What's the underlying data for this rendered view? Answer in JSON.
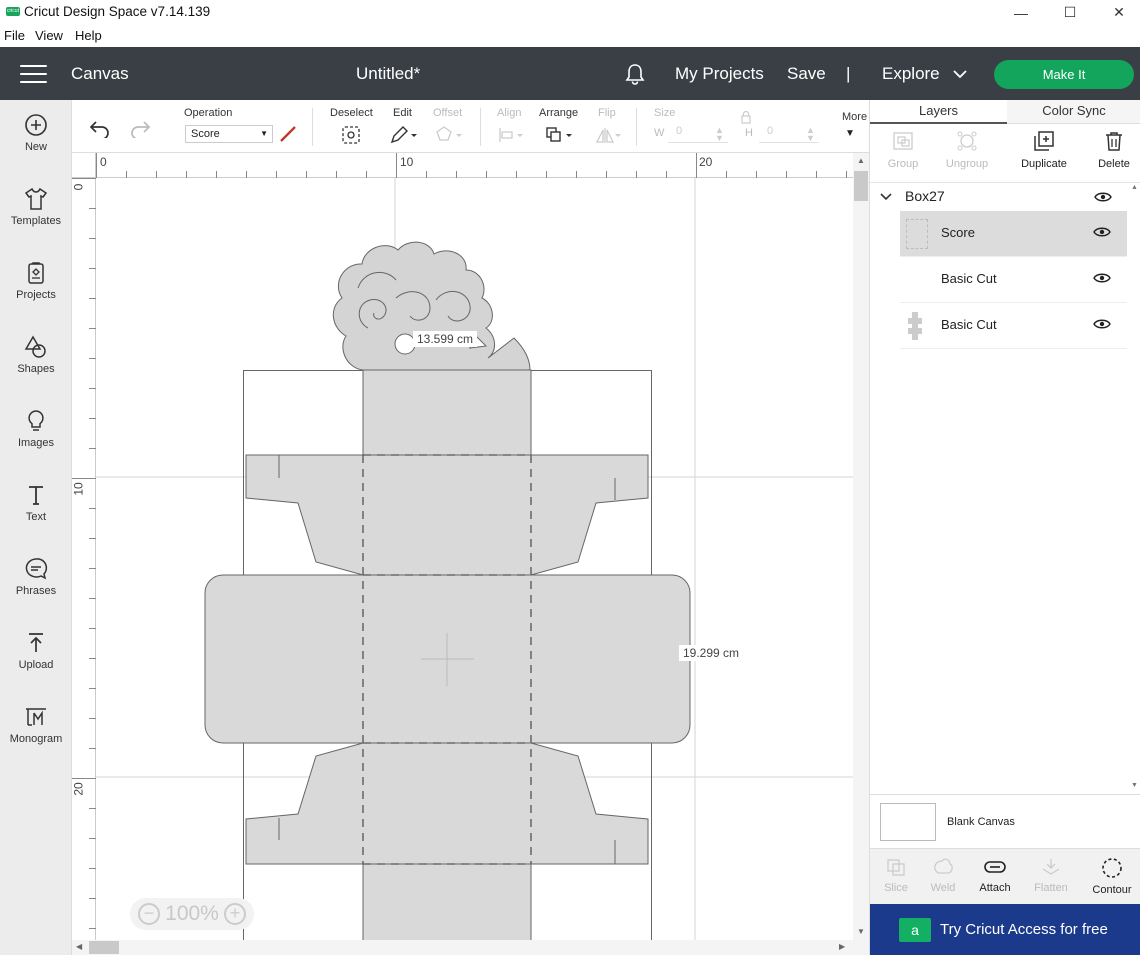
{
  "window": {
    "title": "Cricut Design Space  v7.14.139",
    "logo_text": "cricut",
    "minimize": "—",
    "maximize": "☐",
    "close": "✕"
  },
  "menu": [
    "File",
    "View",
    "Help"
  ],
  "header": {
    "section": "Canvas",
    "project_title": "Untitled*",
    "my_projects": "My Projects",
    "save": "Save",
    "separator": "|",
    "explore": "Explore",
    "make_it": "Make It"
  },
  "sidebar": [
    {
      "label": "New",
      "icon": "plus-circle-icon"
    },
    {
      "label": "Templates",
      "icon": "tshirt-icon"
    },
    {
      "label": "Projects",
      "icon": "projects-icon"
    },
    {
      "label": "Shapes",
      "icon": "shapes-icon"
    },
    {
      "label": "Images",
      "icon": "lightbulb-icon"
    },
    {
      "label": "Text",
      "icon": "text-icon"
    },
    {
      "label": "Phrases",
      "icon": "speech-bubble-icon"
    },
    {
      "label": "Upload",
      "icon": "upload-icon"
    },
    {
      "label": "Monogram",
      "icon": "monogram-icon"
    }
  ],
  "toolbar": {
    "operation_label": "Operation",
    "operation_value": "Score",
    "deselect": "Deselect",
    "edit": "Edit",
    "offset": "Offset",
    "align": "Align",
    "arrange": "Arrange",
    "flip": "Flip",
    "size": "Size",
    "w_label": "W",
    "w_value": "0",
    "h_label": "H",
    "h_value": "0",
    "more": "More"
  },
  "ruler": {
    "top": [
      "0",
      "10",
      "20"
    ],
    "left": [
      "0",
      "10",
      "20"
    ]
  },
  "canvas": {
    "width_label": "13.599 cm",
    "height_label": "19.299 cm",
    "zoom": "100%",
    "zoom_out": "−",
    "zoom_in": "+"
  },
  "right_panel": {
    "tabs": [
      "Layers",
      "Color Sync"
    ],
    "actions": [
      {
        "label": "Group",
        "icon": "group-icon",
        "enabled": false
      },
      {
        "label": "Ungroup",
        "icon": "ungroup-icon",
        "enabled": false
      },
      {
        "label": "Duplicate",
        "icon": "duplicate-icon",
        "enabled": true
      },
      {
        "label": "Delete",
        "icon": "trash-icon",
        "enabled": true
      }
    ],
    "group_name": "Box27",
    "layers": [
      {
        "name": "Score",
        "selected": true
      },
      {
        "name": "Basic Cut",
        "selected": false
      },
      {
        "name": "Basic Cut",
        "selected": false
      }
    ],
    "blank_canvas": "Blank Canvas",
    "bottom_actions": [
      {
        "label": "Slice",
        "enabled": false
      },
      {
        "label": "Weld",
        "enabled": false
      },
      {
        "label": "Attach",
        "enabled": true
      },
      {
        "label": "Flatten",
        "enabled": false
      },
      {
        "label": "Contour",
        "enabled": true
      }
    ],
    "access_badge": "a",
    "access_text": "Try Cricut Access for free"
  },
  "colors": {
    "header_bg": "#3a3f45",
    "make_it": "#12a55b",
    "access_bg": "#1b3a8c",
    "score_line": "#c0392b",
    "shape_fill": "#d9d9d9"
  }
}
